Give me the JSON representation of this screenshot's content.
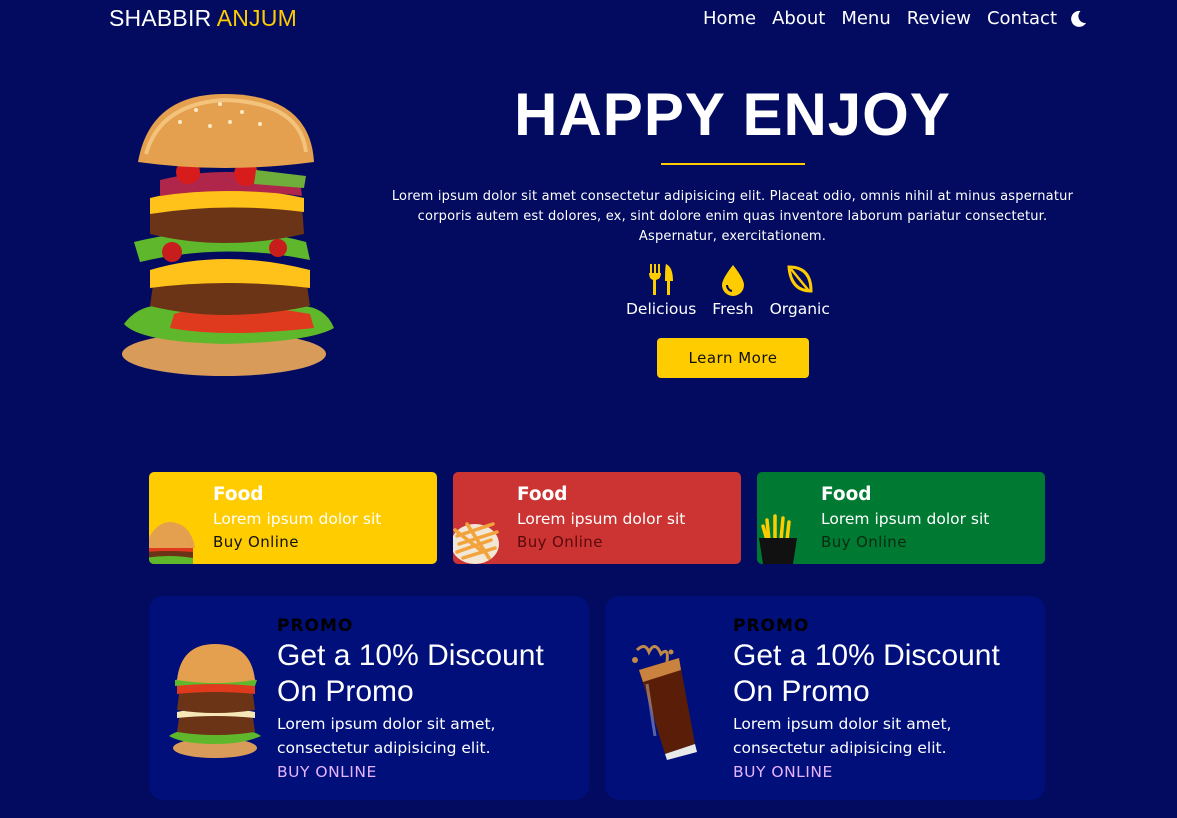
{
  "header": {
    "logo_first": "SHABBIR",
    "logo_second": "ANJUM",
    "nav": [
      "Home",
      "About",
      "Menu",
      "Review",
      "Contact"
    ],
    "theme_icon": "moon-icon"
  },
  "hero": {
    "title": "HAPPY ENJOY",
    "text": "Lorem ipsum dolor sit amet consectetur adipisicing elit. Placeat odio, omnis nihil at minus aspernatur corporis autem est dolores, ex, sint dolore enim quas inventore laborum pariatur consectetur. Aspernatur, exercitationem.",
    "features": [
      {
        "label": "Delicious",
        "icon": "utensils-icon"
      },
      {
        "label": "Fresh",
        "icon": "droplet-icon"
      },
      {
        "label": "Organic",
        "icon": "leaf-icon"
      }
    ],
    "button": "Learn More"
  },
  "cards": [
    {
      "title": "Food",
      "desc": "Lorem ipsum dolor sit",
      "link": "Buy Online",
      "color": "#ffcc00"
    },
    {
      "title": "Food",
      "desc": "Lorem ipsum dolor sit",
      "link": "Buy Online",
      "color": "#cc3333"
    },
    {
      "title": "Food",
      "desc": "Lorem ipsum dolor sit",
      "link": "Buy Online",
      "color": "#007a33"
    }
  ],
  "promos": [
    {
      "label": "PROMO",
      "heading_line1": "Get a 10% Discount",
      "heading_line2": "On Promo",
      "text_line1": "Lorem ipsum dolor sit amet,",
      "text_line2": "consectetur adipisicing elit.",
      "link": "BUY ONLINE"
    },
    {
      "label": "PROMO",
      "heading_line1": "Get a 10% Discount",
      "heading_line2": "On Promo",
      "text_line1": "Lorem ipsum dolor sit amet,",
      "text_line2": "consectetur adipisicing elit.",
      "link": "BUY ONLINE"
    }
  ],
  "colors": {
    "background": "#020b5f",
    "accent": "#ffcc00",
    "promo_bg": "#000f7a",
    "promo_link": "#e7b4ff"
  }
}
